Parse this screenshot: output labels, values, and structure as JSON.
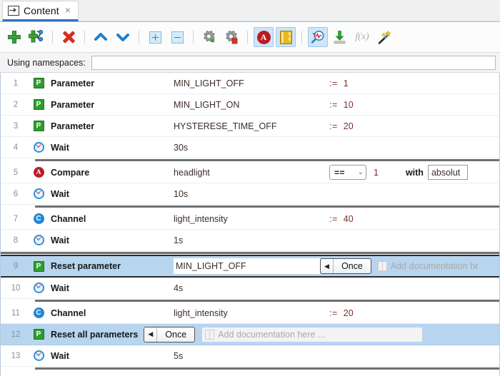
{
  "tab": {
    "icon": "step-into-icon",
    "label": "Content",
    "close": "×"
  },
  "toolbar": {
    "buttons": [
      {
        "name": "add-step-button",
        "icon": "plus-icon",
        "title": "Add"
      },
      {
        "name": "add-linked-step-button",
        "icon": "plus-link-icon",
        "title": "Add linked"
      },
      {
        "name": "delete-step-button",
        "icon": "red-x-icon",
        "title": "Delete"
      },
      {
        "name": "move-up-button",
        "icon": "chevron-up-icon",
        "title": "Move up"
      },
      {
        "name": "move-down-button",
        "icon": "chevron-down-icon",
        "title": "Move down"
      },
      {
        "name": "expand-all-button",
        "icon": "box-plus-icon",
        "title": "Expand all"
      },
      {
        "name": "collapse-all-button",
        "icon": "box-minus-icon",
        "title": "Collapse all"
      },
      {
        "name": "settings-button",
        "icon": "gear-green-icon",
        "title": "Settings"
      },
      {
        "name": "settings-stop-button",
        "icon": "gear-red-icon",
        "title": "Settings stop"
      },
      {
        "name": "compare-toggle-button",
        "icon": "circle-a-icon",
        "title": "Compare",
        "selected": true
      },
      {
        "name": "documentation-toggle-button",
        "icon": "book-icon",
        "title": "Documentation",
        "selected": true
      },
      {
        "name": "analyze-button",
        "icon": "magnifier-signal-icon",
        "title": "Analyze",
        "selected": true
      },
      {
        "name": "import-button",
        "icon": "download-green-icon",
        "title": "Import"
      },
      {
        "name": "function-button",
        "icon": "fx-icon",
        "title": "Function",
        "disabled": true
      },
      {
        "name": "magic-wand-button",
        "icon": "magic-wand-icon",
        "title": "Magic"
      }
    ]
  },
  "namespaces": {
    "label": "Using namespaces:",
    "value": "",
    "placeholder": ""
  },
  "grid": {
    "rows": [
      {
        "num": "1",
        "icon": "parameter-icon",
        "icon_glyph": "P",
        "type": "Parameter",
        "name": "MIN_LIGHT_OFF",
        "op": ":=",
        "value": "1"
      },
      {
        "num": "2",
        "icon": "parameter-icon",
        "icon_glyph": "P",
        "type": "Parameter",
        "name": "MIN_LIGHT_ON",
        "op": ":=",
        "value": "10"
      },
      {
        "num": "3",
        "icon": "parameter-icon",
        "icon_glyph": "P",
        "type": "Parameter",
        "name": "HYSTERESE_TIME_OFF",
        "op": ":=",
        "value": "20"
      },
      {
        "num": "4",
        "icon": "clock-icon",
        "icon_glyph": "",
        "type": "Wait",
        "name": "30s",
        "op": "",
        "value": "",
        "separator_after": true
      },
      {
        "num": "5",
        "icon": "compare-icon",
        "icon_glyph": "A",
        "type": "Compare",
        "name": "headlight",
        "op": "",
        "value": "",
        "comparator": "==",
        "comparator_caret": "⌄",
        "compare_value": "1",
        "with_label": "with",
        "tolerance": "absolut"
      },
      {
        "num": "6",
        "icon": "clock-icon",
        "icon_glyph": "",
        "type": "Wait",
        "name": "10s",
        "op": "",
        "value": "",
        "separator_after": true
      },
      {
        "num": "7",
        "icon": "channel-icon",
        "icon_glyph": "C",
        "type": "Channel",
        "name": "light_intensity",
        "op": ":=",
        "value": "40"
      },
      {
        "num": "8",
        "icon": "clock-icon",
        "icon_glyph": "",
        "type": "Wait",
        "name": "1s",
        "op": "",
        "value": "",
        "separator_after": true
      },
      {
        "num": "9",
        "icon": "parameter-icon",
        "icon_glyph": "P",
        "type": "Reset parameter",
        "name": "MIN_LIGHT_OFF",
        "op": "",
        "value": "",
        "selected": true,
        "focused": true,
        "once_label": "Once",
        "once_arrow": "◀",
        "doc_placeholder": "Add documentation here ..."
      },
      {
        "num": "10",
        "icon": "clock-icon",
        "icon_glyph": "",
        "type": "Wait",
        "name": "4s",
        "op": "",
        "value": "",
        "separator_after": true
      },
      {
        "num": "11",
        "icon": "channel-icon",
        "icon_glyph": "C",
        "type": "Channel",
        "name": "light_intensity",
        "op": ":=",
        "value": "20"
      },
      {
        "num": "12",
        "icon": "parameter-icon",
        "icon_glyph": "P",
        "type": "Reset all parameters",
        "name": "",
        "op": "",
        "value": "",
        "selected": true,
        "once_label": "Once",
        "once_arrow": "◀",
        "doc_placeholder": "Add documentation here ..."
      },
      {
        "num": "13",
        "icon": "clock-icon",
        "icon_glyph": "",
        "type": "Wait",
        "name": "5s",
        "op": "",
        "value": "",
        "separator_after": true
      }
    ]
  },
  "colors": {
    "tab_accent": "#2f72b8",
    "selection": "#b8d5ef",
    "parameter_green": "#2f9e2f",
    "compare_red": "#b81f28",
    "channel_blue": "#1e88d4",
    "separator_gray": "#6f6f6f"
  }
}
